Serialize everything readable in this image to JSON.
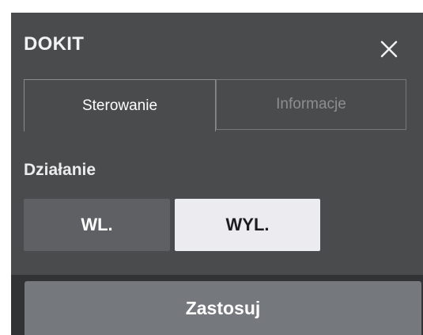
{
  "dialog": {
    "title": "DOKIT",
    "close_icon": "close-icon"
  },
  "tabs": [
    {
      "label": "Sterowanie",
      "active": true
    },
    {
      "label": "Informacje",
      "active": false
    }
  ],
  "action": {
    "label": "Działanie",
    "options": [
      {
        "label": "WL.",
        "selected": false
      },
      {
        "label": "WYL.",
        "selected": true
      }
    ]
  },
  "footer": {
    "apply_label": "Zastosuj"
  },
  "colors": {
    "panel_bg": "#4a4b4d",
    "footer_bg": "#323335",
    "apply_bg": "#75787c",
    "selected_option_bg": "#ebebf0",
    "unselected_option_bg": "#5f6063"
  }
}
